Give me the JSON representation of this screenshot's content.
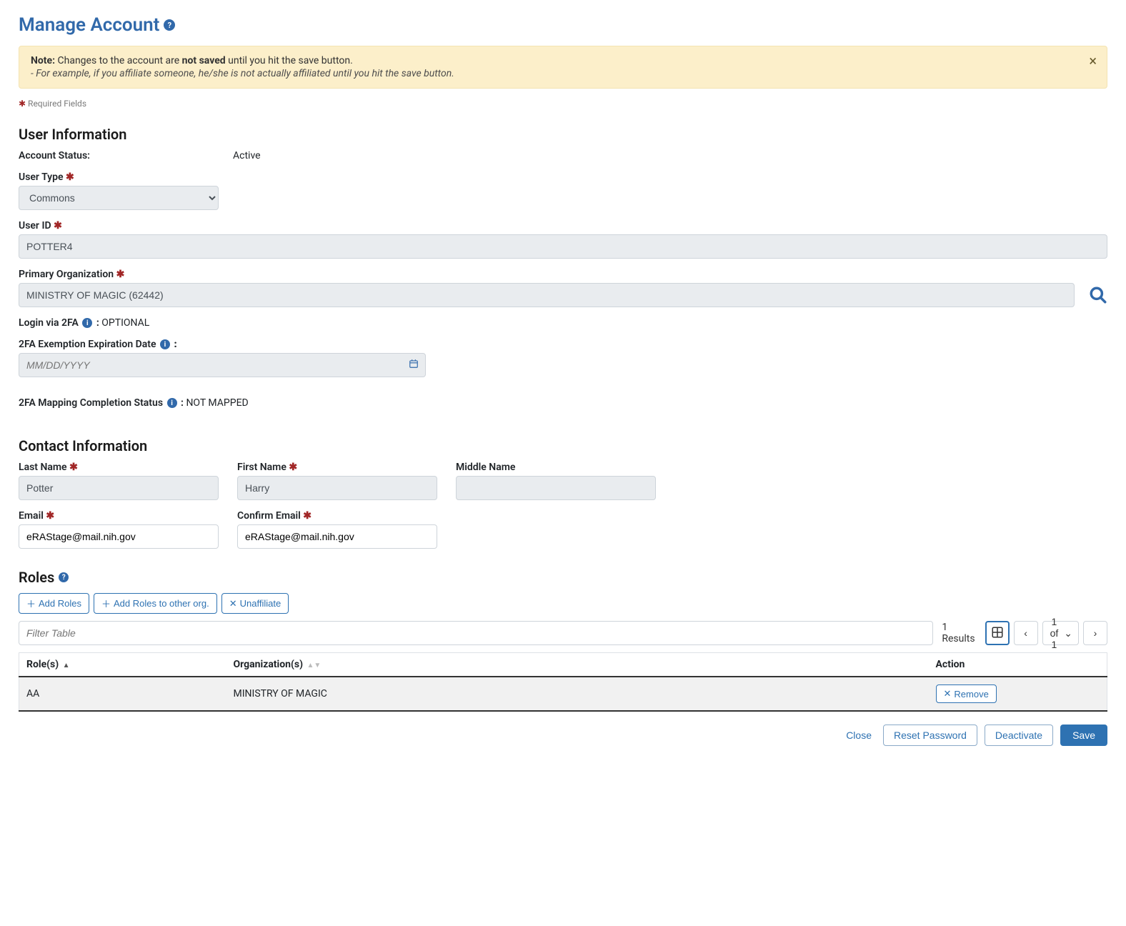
{
  "page": {
    "title": "Manage Account"
  },
  "alert": {
    "note_prefix": "Note:",
    "note_before": " Changes to the account are ",
    "note_bold": "not saved",
    "note_after": " until you hit the save button.",
    "example": "- For example, if you affiliate someone, he/she is not actually affiliated until you hit the save button."
  },
  "required_fields_label": "Required Fields",
  "sections": {
    "user_info": "User Information",
    "contact_info": "Contact Information",
    "roles": "Roles"
  },
  "user_info": {
    "account_status_label": "Account Status:",
    "account_status_value": "Active",
    "user_type_label": "User Type",
    "user_type_value": "Commons",
    "user_id_label": "User ID",
    "user_id_value": "POTTER4",
    "primary_org_label": "Primary Organization",
    "primary_org_value": "MINISTRY OF MAGIC (62442)",
    "login_2fa_label": "Login via 2FA",
    "login_2fa_value": "OPTIONAL",
    "exemption_date_label": "2FA Exemption Expiration Date",
    "exemption_date_placeholder": "MM/DD/YYYY",
    "mapping_status_label": "2FA Mapping Completion Status",
    "mapping_status_value": "NOT MAPPED"
  },
  "contact": {
    "last_name_label": "Last Name",
    "last_name_value": "Potter",
    "first_name_label": "First Name",
    "first_name_value": "Harry",
    "middle_name_label": "Middle Name",
    "middle_name_value": "",
    "email_label": "Email",
    "email_value": "eRAStage@mail.nih.gov",
    "confirm_email_label": "Confirm Email",
    "confirm_email_value": "eRAStage@mail.nih.gov"
  },
  "roles": {
    "add_roles": "Add Roles",
    "add_roles_other": "Add Roles to other org.",
    "unaffiliate": "Unaffiliate",
    "filter_placeholder": "Filter Table",
    "results_count": "1 Results",
    "page_indicator": "1 of 1",
    "col_roles": "Role(s)",
    "col_orgs": "Organization(s)",
    "col_action": "Action",
    "rows": [
      {
        "role": "AA",
        "org": "MINISTRY OF MAGIC",
        "action": "Remove"
      }
    ]
  },
  "footer": {
    "close": "Close",
    "reset_password": "Reset Password",
    "deactivate": "Deactivate",
    "save": "Save"
  }
}
